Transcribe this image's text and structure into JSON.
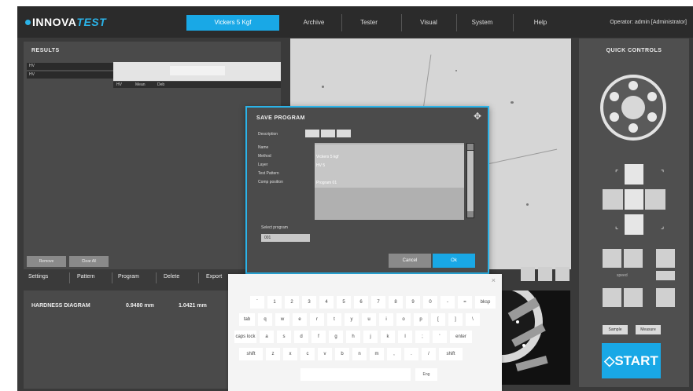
{
  "header": {
    "logo_main": "INNOVA",
    "logo_accent": "TEST",
    "tabs": [
      {
        "label": "Vickers 5 Kgf",
        "active": true
      },
      {
        "label": "Archive",
        "active": false
      },
      {
        "label": "Tester",
        "active": false
      },
      {
        "label": "Visual",
        "active": false
      },
      {
        "label": "System",
        "active": false
      },
      {
        "label": "Help",
        "active": false
      }
    ],
    "operator": "Operator: admin    [Administrator]"
  },
  "results": {
    "title": "RESULTS",
    "rows": [
      "HV",
      "HV"
    ],
    "columns": [
      "HV",
      "Mean",
      "Deb"
    ],
    "buttons": [
      "Remove",
      "Clear All"
    ]
  },
  "bottom_nav": [
    "Settings",
    "Pattern",
    "Program",
    "Delete",
    "Export"
  ],
  "hardness": {
    "title": "HARDNESS DIAGRAM",
    "value1": "0.9480 mm",
    "value2": "1.0421 mm"
  },
  "quick": {
    "title": "QUICK CONTROLS",
    "speed_label": "speed",
    "btn_left": "Sample",
    "btn_right": "Measure",
    "start_label": "START",
    "start_icon": "diamond-icon"
  },
  "dialog": {
    "title": "SAVE PROGRAM",
    "pattern_label": "Description",
    "fields": [
      "Name",
      "Method",
      "Layer",
      "Test Pattern",
      "Comp position"
    ],
    "lines": [
      "",
      "Vickers 5 kgf",
      "HV 5",
      "",
      "Program 01"
    ],
    "select_label": "Select program",
    "select_value": "001",
    "cancel_label": "Cancel",
    "ok_label": "Ok"
  },
  "keyboard": {
    "row1": [
      "`",
      "1",
      "2",
      "3",
      "4",
      "5",
      "6",
      "7",
      "8",
      "9",
      "0",
      "-",
      "=",
      "bksp"
    ],
    "row2": [
      "tab",
      "q",
      "w",
      "e",
      "r",
      "t",
      "y",
      "u",
      "i",
      "o",
      "p",
      "[",
      "]",
      "\\"
    ],
    "row3": [
      "caps lock",
      "a",
      "s",
      "d",
      "f",
      "g",
      "h",
      "j",
      "k",
      "l",
      ";",
      "'",
      "enter"
    ],
    "row4": [
      "shift",
      "z",
      "x",
      "c",
      "v",
      "b",
      "n",
      "m",
      ",",
      ".",
      "/",
      "shift"
    ],
    "lang": "Eng"
  },
  "colors": {
    "accent": "#19a8e6",
    "panel": "#4a4a4a",
    "background": "#3a3a3a"
  }
}
